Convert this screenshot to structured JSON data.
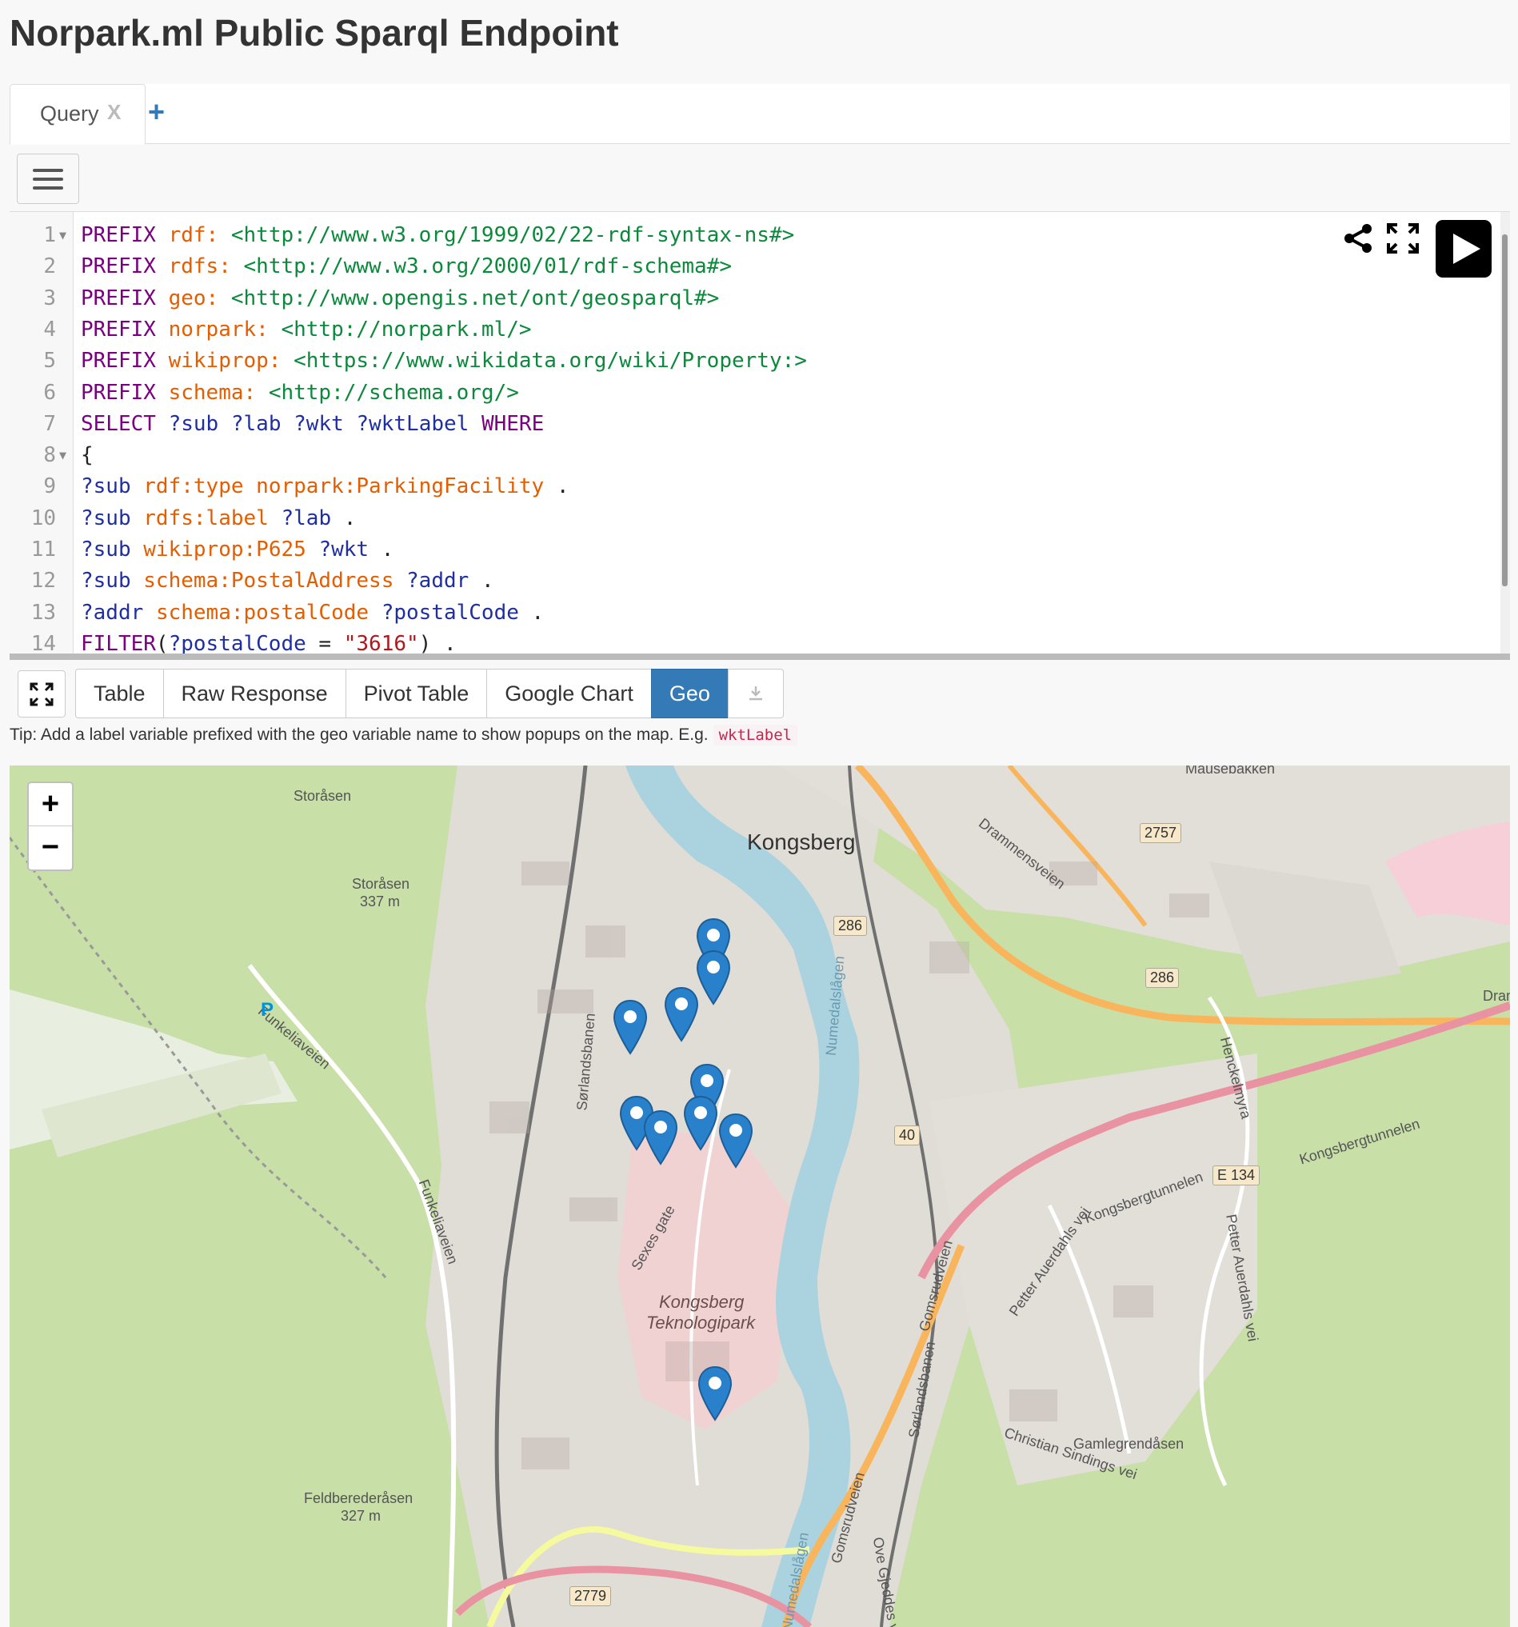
{
  "page": {
    "title": "Norpark.ml Public Sparql Endpoint"
  },
  "tabs": [
    {
      "label": "Query",
      "close": "X"
    }
  ],
  "tab_add": "+",
  "editor": {
    "lines": [
      {
        "n": "1",
        "fold": true,
        "tokens": [
          [
            "kw",
            "PREFIX"
          ],
          [
            "pun",
            " "
          ],
          [
            "pfx",
            "rdf:"
          ],
          [
            "pun",
            " "
          ],
          [
            "iri",
            "<http://www.w3.org/1999/02/22-rdf-syntax-ns#>"
          ]
        ]
      },
      {
        "n": "2",
        "tokens": [
          [
            "kw",
            "PREFIX"
          ],
          [
            "pun",
            " "
          ],
          [
            "pfx",
            "rdfs:"
          ],
          [
            "pun",
            " "
          ],
          [
            "iri",
            "<http://www.w3.org/2000/01/rdf-schema#>"
          ]
        ]
      },
      {
        "n": "3",
        "tokens": [
          [
            "kw",
            "PREFIX"
          ],
          [
            "pun",
            " "
          ],
          [
            "pfx",
            "geo:"
          ],
          [
            "pun",
            " "
          ],
          [
            "iri",
            "<http://www.opengis.net/ont/geosparql#>"
          ]
        ]
      },
      {
        "n": "4",
        "tokens": [
          [
            "kw",
            "PREFIX"
          ],
          [
            "pun",
            " "
          ],
          [
            "pfx",
            "norpark:"
          ],
          [
            "pun",
            " "
          ],
          [
            "iri",
            "<http://norpark.ml/>"
          ]
        ]
      },
      {
        "n": "5",
        "tokens": [
          [
            "kw",
            "PREFIX"
          ],
          [
            "pun",
            " "
          ],
          [
            "pfx",
            "wikiprop:"
          ],
          [
            "pun",
            " "
          ],
          [
            "iri",
            "<https://www.wikidata.org/wiki/Property:>"
          ]
        ]
      },
      {
        "n": "6",
        "tokens": [
          [
            "kw",
            "PREFIX"
          ],
          [
            "pun",
            " "
          ],
          [
            "pfx",
            "schema:"
          ],
          [
            "pun",
            " "
          ],
          [
            "iri",
            "<http://schema.org/>"
          ]
        ]
      },
      {
        "n": "7",
        "tokens": [
          [
            "kw",
            "SELECT"
          ],
          [
            "pun",
            " "
          ],
          [
            "var",
            "?sub"
          ],
          [
            "pun",
            " "
          ],
          [
            "var",
            "?lab"
          ],
          [
            "pun",
            " "
          ],
          [
            "var",
            "?wkt"
          ],
          [
            "pun",
            " "
          ],
          [
            "var",
            "?wktLabel"
          ],
          [
            "pun",
            " "
          ],
          [
            "kw",
            "WHERE"
          ]
        ]
      },
      {
        "n": "8",
        "fold": true,
        "tokens": [
          [
            "pun",
            "{"
          ]
        ]
      },
      {
        "n": "9",
        "tokens": [
          [
            "var",
            "?sub"
          ],
          [
            "pun",
            " "
          ],
          [
            "pn",
            "rdf:type"
          ],
          [
            "pun",
            " "
          ],
          [
            "pn",
            "norpark:ParkingFacility"
          ],
          [
            "pun",
            " ."
          ]
        ]
      },
      {
        "n": "10",
        "tokens": [
          [
            "var",
            "?sub"
          ],
          [
            "pun",
            " "
          ],
          [
            "pn",
            "rdfs:label"
          ],
          [
            "pun",
            " "
          ],
          [
            "var",
            "?lab"
          ],
          [
            "pun",
            " ."
          ]
        ]
      },
      {
        "n": "11",
        "tokens": [
          [
            "var",
            "?sub"
          ],
          [
            "pun",
            " "
          ],
          [
            "pn",
            "wikiprop:P625"
          ],
          [
            "pun",
            " "
          ],
          [
            "var",
            "?wkt"
          ],
          [
            "pun",
            " ."
          ]
        ]
      },
      {
        "n": "12",
        "tokens": [
          [
            "var",
            "?sub"
          ],
          [
            "pun",
            " "
          ],
          [
            "pn",
            "schema:PostalAddress"
          ],
          [
            "pun",
            " "
          ],
          [
            "var",
            "?addr"
          ],
          [
            "pun",
            " ."
          ]
        ]
      },
      {
        "n": "13",
        "tokens": [
          [
            "var",
            "?addr"
          ],
          [
            "pun",
            " "
          ],
          [
            "pn",
            "schema:postalCode"
          ],
          [
            "pun",
            " "
          ],
          [
            "var",
            "?postalCode"
          ],
          [
            "pun",
            " ."
          ]
        ]
      },
      {
        "n": "14",
        "tokens": [
          [
            "kw",
            "FILTER"
          ],
          [
            "pun",
            "("
          ],
          [
            "var",
            "?postalCode"
          ],
          [
            "pun",
            " = "
          ],
          [
            "str",
            "\"3616\""
          ],
          [
            "pun",
            ") ."
          ]
        ]
      }
    ]
  },
  "results": {
    "buttons": [
      "Table",
      "Raw Response",
      "Pivot Table",
      "Google Chart",
      "Geo"
    ],
    "active": "Geo"
  },
  "tip": {
    "text": "Tip: Add a label variable prefixed with the geo variable name to show popups on the map. E.g.",
    "code": "wktLabel"
  },
  "map": {
    "zoom_in": "+",
    "zoom_out": "−",
    "labels": {
      "storasen_top": "Storåsen",
      "storasen": "Storåsen",
      "storasen_m": "337 m",
      "kongsberg": "Kongsberg",
      "drammensveien": "Drammensveien",
      "mausebakken": "Mausebakken",
      "funkelia": "Funkeliaveien",
      "funkelia2": "Funkeliaveien",
      "sorlandsbanen": "Sørlandsbanen",
      "sorlandsbanen2": "Sørlandsbanen",
      "numedalslagen": "Numedalslågen",
      "numedalslagen2": "Numedalslågen",
      "sexes_gate": "Sexes gate",
      "teknologipark1": "Kongsberg",
      "teknologipark2": "Teknologipark",
      "gomsrudveien": "Gomsrudveien",
      "gomsrudveien2": "Gomsrudveien",
      "kongsbergtunnelen": "Kongsbergtunnelen",
      "kongsbergtunnelen2": "Kongsbergtunnelen",
      "petter_auerdahls": "Petter Auerdahls vei",
      "petter_auerdahls2": "Petter Auerdahls vei",
      "henckelmyra": "Henckelmyra",
      "gamlegrendasen": "Gamlegrendåsen",
      "christian_sindings": "Christian Sindings vei",
      "feldberedrasen": "Feldberederåsen",
      "feldberedrasen_m": "327 m",
      "ove_gjeddes": "Ove Gjeddes vei",
      "dram": "Dram",
      "parking": "P"
    },
    "shields": [
      "2757",
      "286",
      "286",
      "40",
      "E 134",
      "2779"
    ],
    "marker_count": 10
  }
}
